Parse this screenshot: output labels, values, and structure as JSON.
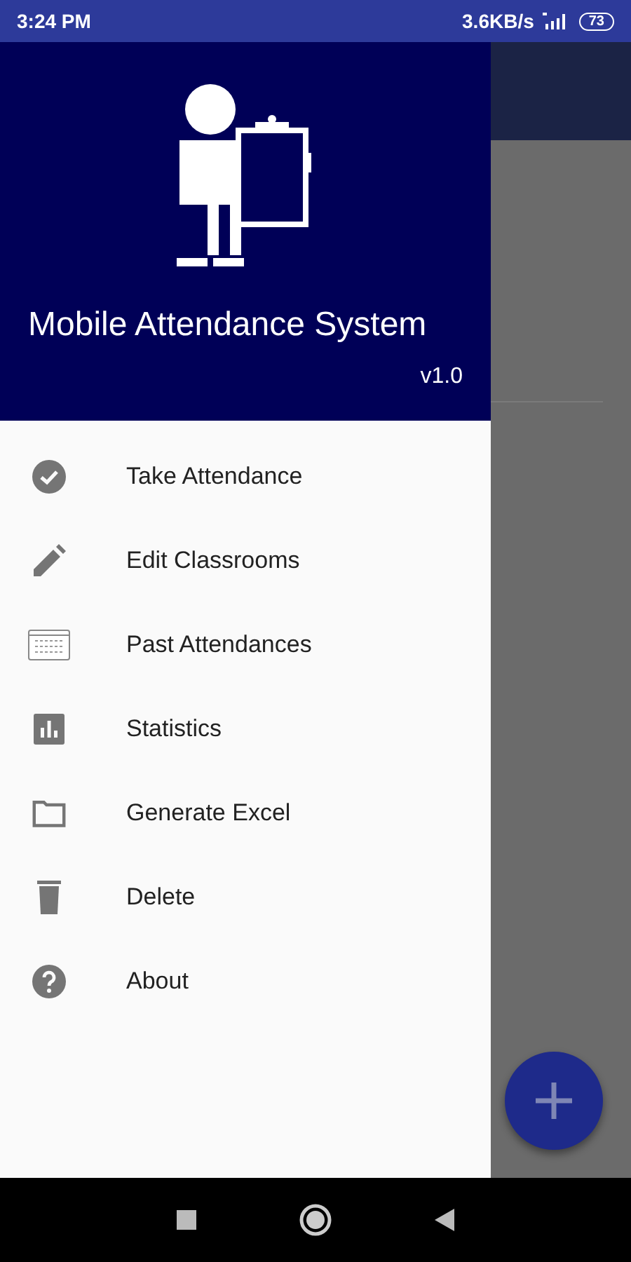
{
  "status_bar": {
    "time": "3:24 PM",
    "speed": "3.6KB/s",
    "battery": "73"
  },
  "drawer": {
    "title": "Mobile Attendance System",
    "version": "v1.0",
    "items": [
      {
        "label": "Take Attendance",
        "kind": "check"
      },
      {
        "label": "Edit Classrooms",
        "kind": "pencil"
      },
      {
        "label": "Past Attendances",
        "kind": "calendar"
      },
      {
        "label": "Statistics",
        "kind": "chart"
      },
      {
        "label": "Generate Excel",
        "kind": "folder"
      },
      {
        "label": "Delete",
        "kind": "trash"
      },
      {
        "label": "About",
        "kind": "help"
      }
    ]
  }
}
